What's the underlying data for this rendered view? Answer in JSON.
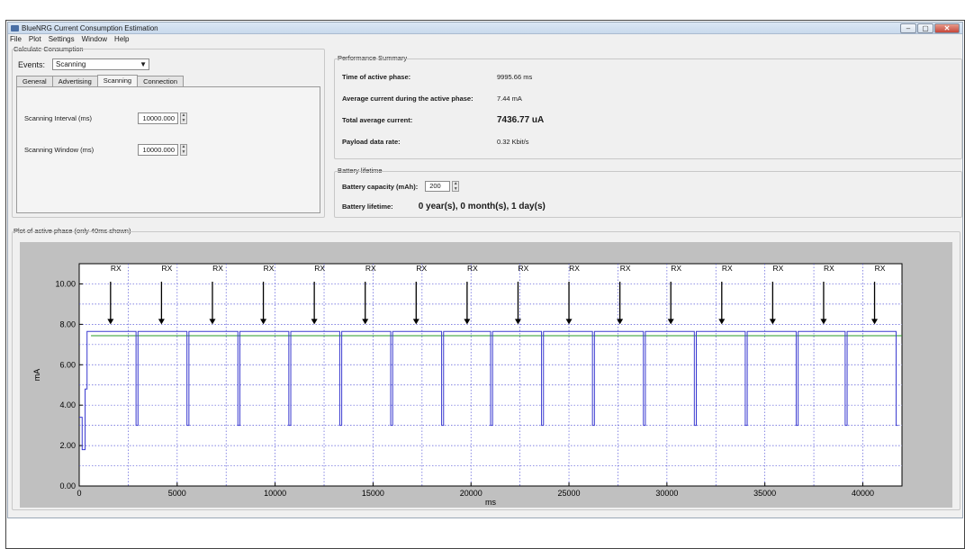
{
  "window": {
    "title": "BlueNRG Current Consumption Estimation",
    "controls": {
      "minimize": "–",
      "maximize": "▢",
      "close": "✕"
    }
  },
  "menu": [
    "File",
    "Plot",
    "Settings",
    "Window",
    "Help"
  ],
  "calculate": {
    "group_title": "Calculate Consumption",
    "events_label": "Events:",
    "events_value": "Scanning",
    "tabs": [
      "General",
      "Advertising",
      "Scanning",
      "Connection"
    ],
    "active_tab": "Scanning",
    "fields": [
      {
        "label": "Scanning Interval (ms)",
        "value": "10000.000"
      },
      {
        "label": "Scanning Window (ms)",
        "value": "10000.000"
      }
    ]
  },
  "performance": {
    "group_title": "Performance Summary",
    "rows": [
      {
        "label": "Time of active phase:",
        "value": "9995.66 ms"
      },
      {
        "label": "Average current during the active phase:",
        "value": "7.44 mA"
      },
      {
        "label": "Total average current:",
        "value": "7436.77 uA"
      },
      {
        "label": "Payload data rate:",
        "value": "0.32 Kbit/s"
      }
    ]
  },
  "battery": {
    "group_title": "Battery lifetime",
    "capacity_label": "Battery capacity (mAh):",
    "capacity_value": "200",
    "lifetime_label": "Battery lifetime:",
    "lifetime_value": "0 year(s), 0 month(s), 1 day(s)"
  },
  "plot": {
    "group_title": "Plot of active phase (only 40ms shown)"
  },
  "colors": {
    "current_trace": "#3a3ad0",
    "average_line": "#2a9a2a",
    "plot_background": "#c0c0c0",
    "grid": "#5a5ad8"
  },
  "chart_data": {
    "type": "line",
    "title": "",
    "xlabel": "ms",
    "ylabel": "mA",
    "xlim": [
      0,
      42000
    ],
    "ylim": [
      0,
      11
    ],
    "x_ticks": [
      0,
      5000,
      10000,
      15000,
      20000,
      25000,
      30000,
      35000,
      40000
    ],
    "y_ticks": [
      "0.00",
      "2.00",
      "4.00",
      "6.00",
      "8.00",
      "10.00"
    ],
    "grid": true,
    "series": [
      {
        "name": "",
        "x": [
          0,
          150,
          150,
          300,
          300,
          400,
          400,
          600,
          600,
          2900,
          2900,
          3000,
          3000,
          5500,
          5500,
          5600,
          5600,
          8100,
          8100,
          8200,
          8200,
          10700,
          10700,
          10800,
          10800,
          13300,
          13300,
          13400,
          13400,
          15900,
          15900,
          16000,
          16000,
          18500,
          18500,
          18600,
          18600,
          21000,
          21000,
          21100,
          21100,
          23600,
          23600,
          23700,
          23700,
          26200,
          26200,
          26300,
          26300,
          28800,
          28800,
          28900,
          28900,
          31400,
          31400,
          31500,
          31500,
          34000,
          34000,
          34100,
          34100,
          36600,
          36600,
          36700,
          36700,
          39100,
          39100,
          39200,
          39200,
          41700,
          41700,
          41800
        ],
        "y": [
          3.4,
          3.4,
          1.8,
          1.8,
          4.8,
          4.8,
          7.65,
          7.65,
          7.65,
          7.65,
          3.0,
          3.0,
          7.65,
          7.65,
          3.0,
          3.0,
          7.65,
          7.65,
          3.0,
          3.0,
          7.65,
          7.65,
          3.0,
          3.0,
          7.65,
          7.65,
          3.0,
          3.0,
          7.65,
          7.65,
          3.0,
          3.0,
          7.65,
          7.65,
          3.0,
          3.0,
          7.65,
          7.65,
          3.0,
          3.0,
          7.65,
          7.65,
          3.0,
          3.0,
          7.65,
          7.65,
          3.0,
          3.0,
          7.65,
          7.65,
          3.0,
          3.0,
          7.65,
          7.65,
          3.0,
          3.0,
          7.65,
          7.65,
          3.0,
          3.0,
          7.65,
          7.65,
          3.0,
          3.0,
          7.65,
          7.65,
          3.0,
          3.0,
          7.65,
          7.65,
          3.0,
          3.0
        ]
      },
      {
        "name": "",
        "x": [
          600,
          42000
        ],
        "y": [
          7.44,
          7.44
        ]
      }
    ],
    "annotations": {
      "text": "RX",
      "x": [
        1600,
        4200,
        6800,
        9400,
        12000,
        14600,
        17200,
        19800,
        22400,
        25000,
        27600,
        30200,
        32800,
        35400,
        38000,
        40600
      ],
      "arrow_to_y": 8.0
    }
  }
}
